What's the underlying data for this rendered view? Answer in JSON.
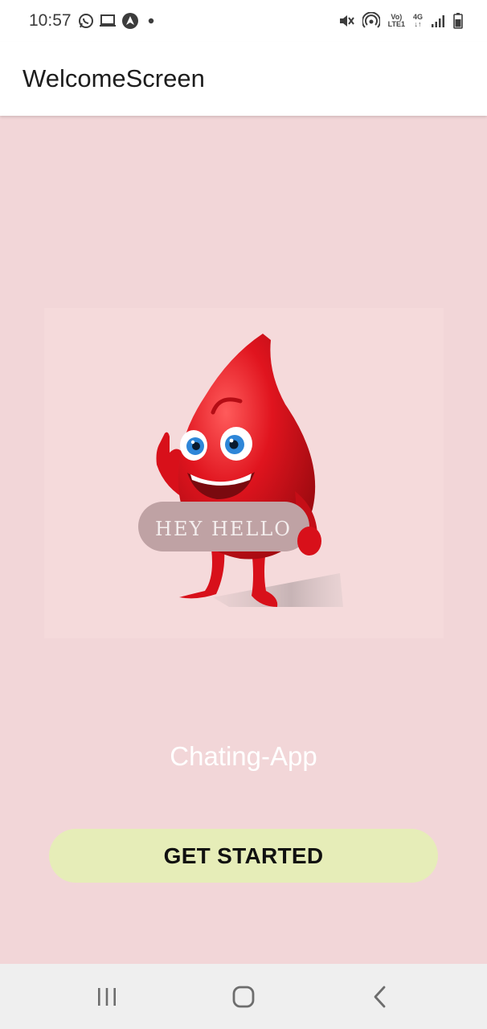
{
  "status_bar": {
    "time": "10:57",
    "left_icons": [
      "whatsapp-icon",
      "laptop-icon",
      "nav-arrow-icon",
      "dot-icon"
    ],
    "right_icons": [
      "mute-icon",
      "hotspot-icon",
      "volte-icon",
      "4g-icon",
      "signal-icon",
      "battery-icon"
    ],
    "volte_top": "Vo)",
    "volte_bottom": "LTE1",
    "net_top": "4G",
    "net_bottom": "↓↑"
  },
  "app_bar": {
    "title": "WelcomeScreen"
  },
  "illustration": {
    "sign_text": "HEY HELLO"
  },
  "main": {
    "app_name": "Chating-App",
    "get_started_label": "GET STARTED"
  },
  "nav_bar": {
    "buttons": [
      "recent-apps-icon",
      "home-icon",
      "back-icon"
    ]
  },
  "colors": {
    "background": "#f2d6d8",
    "button": "#e6edb8",
    "drop_red": "#e0141e",
    "app_bar": "#ffffff"
  }
}
